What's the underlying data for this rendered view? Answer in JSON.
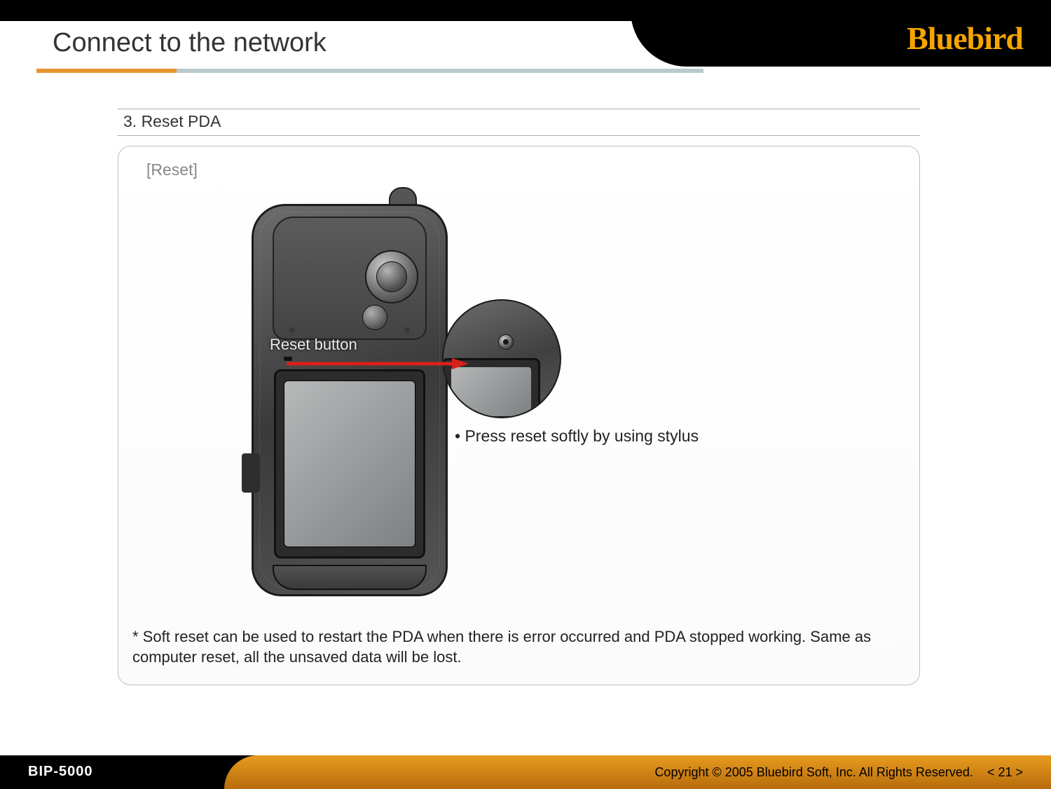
{
  "brand": "Bluebird",
  "header": {
    "title": "Connect to the network"
  },
  "section": {
    "step_title": "3. Reset PDA",
    "panel_label": "[Reset]",
    "reset_button_label": "Reset button",
    "instruction": "• Press reset softly by using stylus",
    "note": "* Soft reset can be used to restart the PDA when there is error occurred and PDA stopped working. Same as computer reset, all the unsaved data will be lost."
  },
  "footer": {
    "model": "BIP-5000",
    "copyright": "Copyright © 2005 Bluebird Soft, Inc. All Rights Reserved.",
    "page_label": "< 21 >"
  }
}
